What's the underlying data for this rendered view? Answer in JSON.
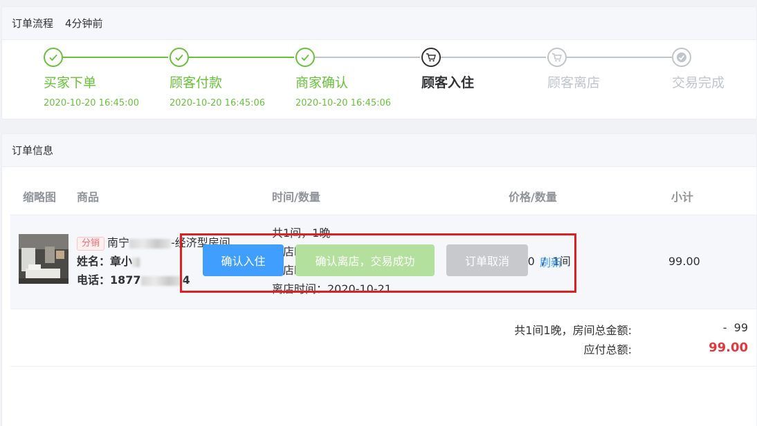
{
  "flow": {
    "title": "订单流程",
    "updated": "4分钟前",
    "steps": [
      {
        "title": "买家下单",
        "time": "2020-10-20 16:45:00",
        "status": "done"
      },
      {
        "title": "顾客付款",
        "time": "2020-10-20 16:45:06",
        "status": "done"
      },
      {
        "title": "商家确认",
        "time": "2020-10-20 16:45:06",
        "status": "done"
      },
      {
        "title": "顾客入住",
        "time": "",
        "status": "current"
      },
      {
        "title": "顾客离店",
        "time": "",
        "status": "pending"
      },
      {
        "title": "交易完成",
        "time": "",
        "status": "pending"
      }
    ]
  },
  "info": {
    "title": "订单信息",
    "columns": [
      "缩略图",
      "商品",
      "时间/数量",
      "价格/数量",
      "小计"
    ],
    "item": {
      "badge": "分销",
      "name_prefix": "南宁",
      "name_suffix": "-经济型房间",
      "guest_label": "姓名：",
      "guest_visible": "章小",
      "phone_label": "电话：",
      "phone_prefix": "1877",
      "phone_suffix": "4",
      "rooms_nights": "共1间，1晚",
      "arrival": "到店时间：20:00",
      "checkin": "入店时间：2020-10-20",
      "checkout": "离店时间：2020-10-21",
      "price_qty": "99.00  /  1间",
      "subtotal": "99.00"
    },
    "summary": {
      "rooms_label": "共1间1晚，房间总金额:",
      "rooms_value": "-  99",
      "total_label": "应付总额:",
      "total_value": "99.00"
    }
  },
  "actions": {
    "confirm_checkin": "确认入住",
    "confirm_checkout": "确认离店，交易成功",
    "cancel_order": "订单取消",
    "refresh": "刷新"
  },
  "colors": {
    "done": "#67c23a",
    "current": "#303133",
    "pending": "#c0c4cc",
    "primary": "#409eff",
    "primary_disabled": "#b3e19d",
    "cancel_disabled": "#c8c9cc",
    "price": "#f56c6c",
    "highlight_border": "#e02020"
  }
}
